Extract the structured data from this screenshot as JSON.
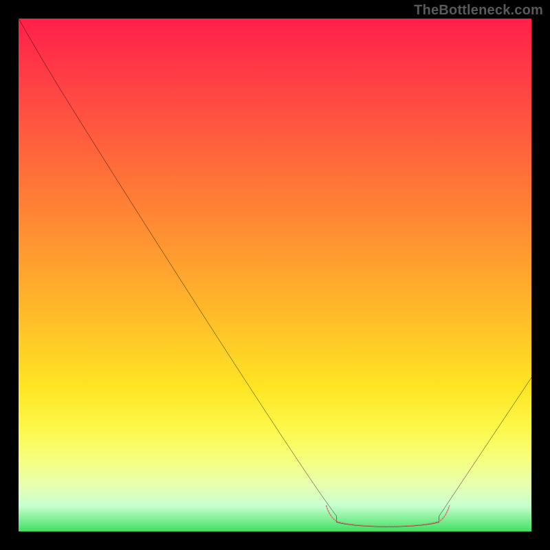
{
  "watermark": "TheBottleneck.com",
  "colors": {
    "background": "#000000",
    "gradient_top": "#ff1f4a",
    "gradient_bottom": "#3fe060",
    "curve": "#000000",
    "optimal_marker": "#e06a6a",
    "watermark_text": "#5a5a5a"
  },
  "chart_data": {
    "type": "line",
    "title": "",
    "xlabel": "",
    "ylabel": "",
    "xlim": [
      0,
      100
    ],
    "ylim": [
      0,
      100
    ],
    "note": "Axes are unlabeled; x and y given as 0–100 percent of plot area. y measured from top (0) to bottom (100).",
    "series": [
      {
        "name": "bottleneck-curve",
        "x": [
          0,
          5,
          10,
          15,
          20,
          25,
          30,
          35,
          40,
          45,
          50,
          55,
          60,
          62,
          66,
          72,
          78,
          82,
          85,
          90,
          95,
          100
        ],
        "y": [
          0,
          8,
          17,
          25,
          33,
          41,
          49,
          57,
          64,
          72,
          80,
          88,
          95,
          98,
          99,
          99,
          99,
          98,
          93,
          86,
          78,
          70
        ]
      },
      {
        "name": "optimal-range",
        "x": [
          60,
          62,
          66,
          72,
          78,
          82,
          84
        ],
        "y": [
          95,
          98,
          99,
          99,
          99,
          98,
          95
        ]
      }
    ],
    "background_gradient": {
      "orientation": "vertical",
      "stops": [
        {
          "pos": 0.0,
          "color": "#ff1f4a"
        },
        {
          "pos": 0.28,
          "color": "#ff6a3a"
        },
        {
          "pos": 0.6,
          "color": "#ffc228"
        },
        {
          "pos": 0.8,
          "color": "#fdf84a"
        },
        {
          "pos": 0.95,
          "color": "#c8ffd0"
        },
        {
          "pos": 1.0,
          "color": "#3fe060"
        }
      ]
    }
  }
}
